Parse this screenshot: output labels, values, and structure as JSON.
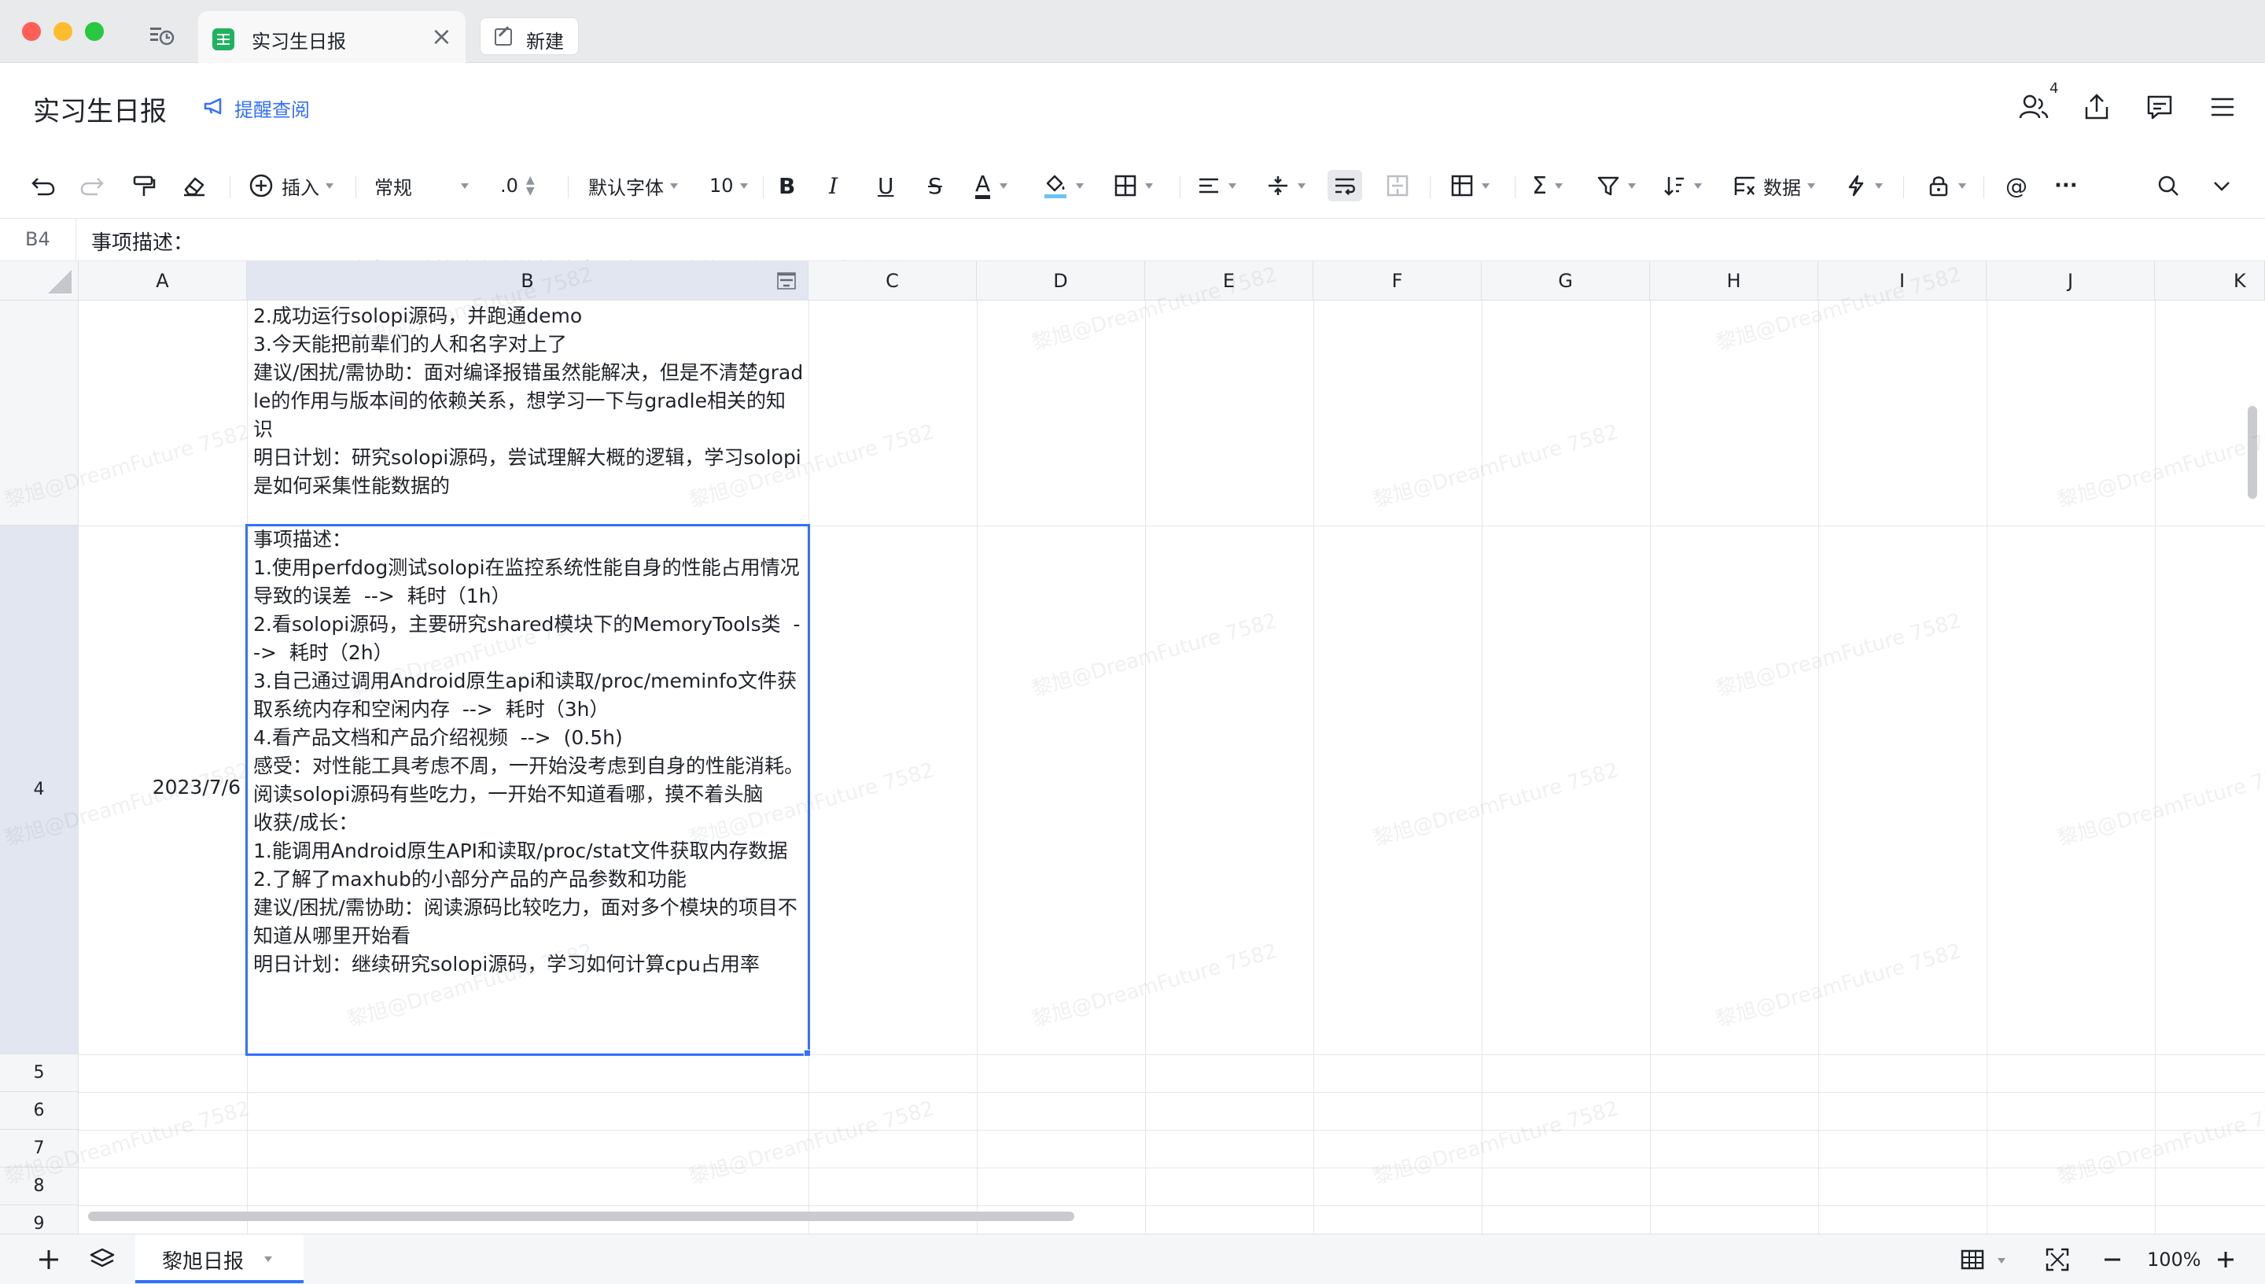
{
  "tabs": {
    "active_title": "实习生日报",
    "new_tab_label": "新建"
  },
  "header": {
    "doc_title": "实习生日报",
    "remind_label": "提醒查阅",
    "collaborators_count": "4"
  },
  "toolbar": {
    "insert_label": "插入",
    "format_label": "常规",
    "decimal_label": ".0",
    "font_label": "默认字体",
    "font_size": "10",
    "bold": "B",
    "italic": "I",
    "underline": "U",
    "strike": "S",
    "text_color": "A",
    "data_label": "数据",
    "more": "···"
  },
  "formula_bar": {
    "cell_ref": "B4",
    "content_line1": "事项描述：",
    "content_line2": "1.使用perfdog测试solopi在监控系统性能自身的性能占用情况导致的误差  -->  耗时（1h）"
  },
  "columns": [
    "A",
    "B",
    "C",
    "D",
    "E",
    "F",
    "G",
    "H",
    "I",
    "J",
    "K"
  ],
  "rows": {
    "row4_number": "4",
    "row5": "5",
    "row6": "6",
    "row7": "7",
    "row8": "8",
    "row9": "9"
  },
  "cells": {
    "b3_text": "2.成功运行solopi源码，并跑通demo\n3.今天能把前辈们的人和名字对上了\n建议/困扰/需协助：面对编译报错虽然能解决，但是不清楚gradle的作用与版本间的依赖关系，想学习一下与gradle相关的知识\n明日计划：研究solopi源码，尝试理解大概的逻辑，学习solopi是如何采集性能数据的",
    "a4_date": "2023/7/6",
    "b4_text": "事项描述：\n1.使用perfdog测试solopi在监控系统性能自身的性能占用情况导致的误差  -->  耗时（1h）\n2.看solopi源码，主要研究shared模块下的MemoryTools类  -->  耗时（2h）\n3.自己通过调用Android原生api和读取/proc/meminfo文件获取系统内存和空闲内存  -->  耗时（3h）\n4.看产品文档和产品介绍视频  -->  (0.5h)\n感受：对性能工具考虑不周，一开始没考虑到自身的性能消耗。阅读solopi源码有些吃力，一开始不知道看哪，摸不着头脑\n收获/成长：\n1.能调用Android原生API和读取/proc/stat文件获取内存数据\n2.了解了maxhub的小部分产品的产品参数和功能\n建议/困扰/需协助：阅读源码比较吃力，面对多个模块的项目不知道从哪里开始看\n明日计划：继续研究solopi源码，学习如何计算cpu占用率"
  },
  "sheet_bar": {
    "sheet_name": "黎旭日报",
    "zoom": "100%"
  },
  "watermark": "黎旭@DreamFuture 7582",
  "colors": {
    "accent": "#3370ff",
    "header_bg": "#f5f6f7",
    "selected_header_bg": "#e1e6f1"
  }
}
